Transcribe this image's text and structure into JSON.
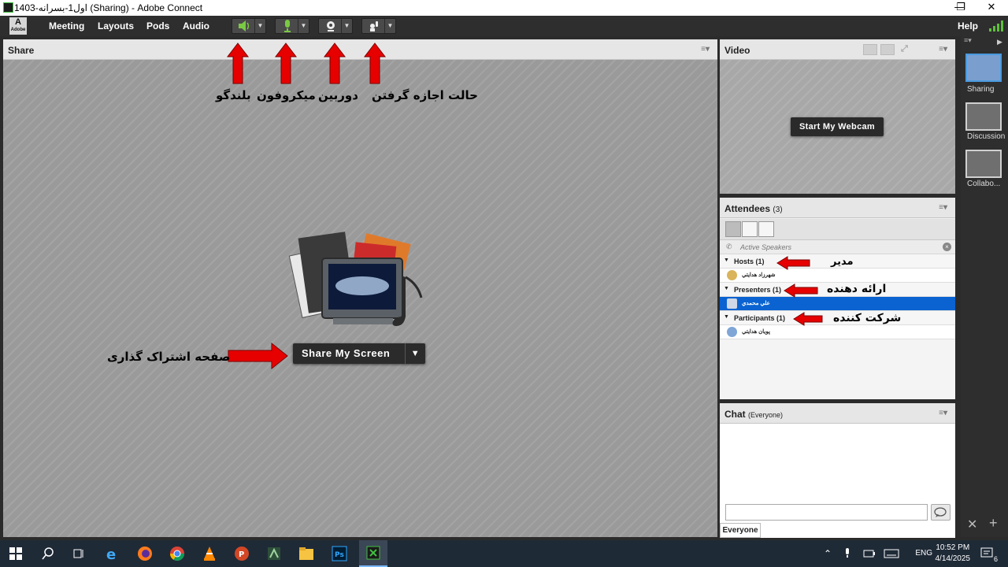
{
  "window": {
    "title": "اول1-بسرانه-1403 (Sharing) - Adobe Connect",
    "minimize": "—",
    "maximize": "❐",
    "close": "✕"
  },
  "menubar": {
    "logo": "A",
    "logo_sub": "Adobe",
    "items": [
      "Meeting",
      "Layouts",
      "Pods",
      "Audio"
    ],
    "help": "Help"
  },
  "share_pod": {
    "title": "Share",
    "button_label": "Share My Screen"
  },
  "video_pod": {
    "title": "Video",
    "webcam_button": "Start My Webcam"
  },
  "attendees_pod": {
    "title": "Attendees",
    "count": "(3)",
    "active_speakers": "Active Speakers",
    "groups": [
      {
        "label": "Hosts (1)",
        "member": "شهرزاد هدايتي"
      },
      {
        "label": "Presenters (1)",
        "member": "علي محمدي"
      },
      {
        "label": "Participants (1)",
        "member": "پويان هدايتي"
      }
    ]
  },
  "chat_pod": {
    "title": "Chat",
    "scope": "(Everyone)",
    "tab": "Everyone"
  },
  "layouts_panel": {
    "items": [
      "Sharing",
      "Discussion",
      "Collabo..."
    ]
  },
  "annotations": {
    "speaker": "بلندگو",
    "microphone": "میکروفون",
    "camera": "دوربین",
    "permission": "حالت اجازه گرفتن",
    "share_screen": "صفحه اشتراک گذاری",
    "host": "مدیر",
    "presenter": "ارائه دهنده",
    "participant": "شرکت کننده"
  },
  "taskbar": {
    "language": "ENG",
    "time": "10:52 PM",
    "date": "4/14/2025",
    "notifications": "6"
  },
  "colors": {
    "accent": "#0a63d1",
    "arrow": "#e60000",
    "mic_green": "#7ac943"
  }
}
